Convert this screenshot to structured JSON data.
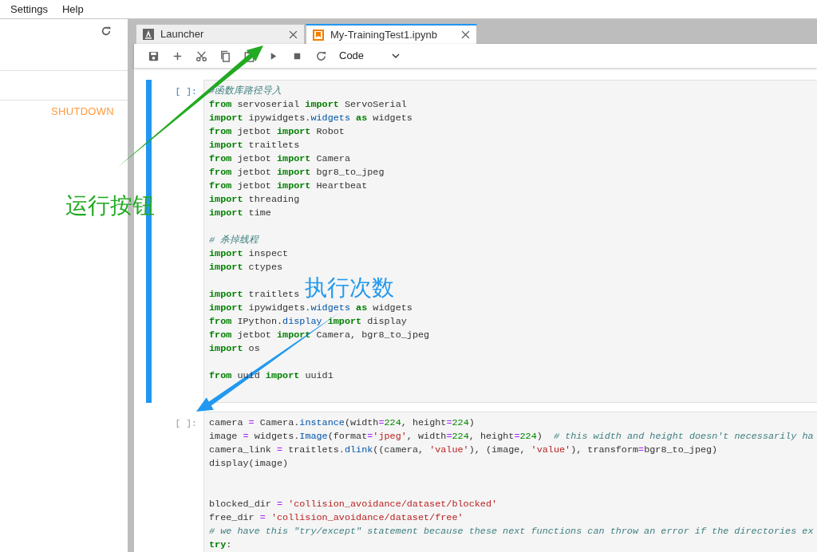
{
  "menu": [
    {
      "label": "Settings"
    },
    {
      "label": "Help"
    }
  ],
  "sidebar": {
    "shutdown": "SHUTDOWN"
  },
  "tabs": [
    {
      "label": "Launcher",
      "kind": "launcher",
      "selected": false
    },
    {
      "label": "My-TrainingTest1.ipynb",
      "kind": "notebook",
      "selected": true
    }
  ],
  "toolbar": {
    "cell_type": "Code"
  },
  "cells": [
    {
      "prompt": "[ ]:",
      "selected": true,
      "lines": [
        {
          "kind": "code",
          "tokens": [
            {
              "kind": "cmt",
              "text": "#函数库路径导入"
            }
          ]
        },
        {
          "kind": "code",
          "tokens": [
            {
              "kind": "kw",
              "text": "from"
            },
            {
              "kind": "plain",
              "text": " servoserial "
            },
            {
              "kind": "kw",
              "text": "import"
            },
            {
              "kind": "plain",
              "text": " ServoSerial"
            }
          ]
        },
        {
          "kind": "code",
          "tokens": [
            {
              "kind": "kw",
              "text": "import"
            },
            {
              "kind": "plain",
              "text": " ipywidgets."
            },
            {
              "kind": "attr",
              "text": "widgets"
            },
            {
              "kind": "kw",
              "text": " as"
            },
            {
              "kind": "plain",
              "text": " widgets"
            }
          ]
        },
        {
          "kind": "code",
          "tokens": [
            {
              "kind": "kw",
              "text": "from"
            },
            {
              "kind": "plain",
              "text": " jetbot "
            },
            {
              "kind": "kw",
              "text": "import"
            },
            {
              "kind": "plain",
              "text": " Robot"
            }
          ]
        },
        {
          "kind": "code",
          "tokens": [
            {
              "kind": "kw",
              "text": "import"
            },
            {
              "kind": "plain",
              "text": " traitlets"
            }
          ]
        },
        {
          "kind": "code",
          "tokens": [
            {
              "kind": "kw",
              "text": "from"
            },
            {
              "kind": "plain",
              "text": " jetbot "
            },
            {
              "kind": "kw",
              "text": "import"
            },
            {
              "kind": "plain",
              "text": " Camera"
            }
          ]
        },
        {
          "kind": "code",
          "tokens": [
            {
              "kind": "kw",
              "text": "from"
            },
            {
              "kind": "plain",
              "text": " jetbot "
            },
            {
              "kind": "kw",
              "text": "import"
            },
            {
              "kind": "plain",
              "text": " bgr8_to_jpeg"
            }
          ]
        },
        {
          "kind": "code",
          "tokens": [
            {
              "kind": "kw",
              "text": "from"
            },
            {
              "kind": "plain",
              "text": " jetbot "
            },
            {
              "kind": "kw",
              "text": "import"
            },
            {
              "kind": "plain",
              "text": " Heartbeat"
            }
          ]
        },
        {
          "kind": "code",
          "tokens": [
            {
              "kind": "kw",
              "text": "import"
            },
            {
              "kind": "plain",
              "text": " threading"
            }
          ]
        },
        {
          "kind": "code",
          "tokens": [
            {
              "kind": "kw",
              "text": "import"
            },
            {
              "kind": "plain",
              "text": " time"
            }
          ]
        },
        {
          "kind": "blank"
        },
        {
          "kind": "code",
          "tokens": [
            {
              "kind": "cmt",
              "text": "# 杀掉线程"
            }
          ]
        },
        {
          "kind": "code",
          "tokens": [
            {
              "kind": "kw",
              "text": "import"
            },
            {
              "kind": "plain",
              "text": " inspect"
            }
          ]
        },
        {
          "kind": "code",
          "tokens": [
            {
              "kind": "kw",
              "text": "import"
            },
            {
              "kind": "plain",
              "text": " ctypes"
            }
          ]
        },
        {
          "kind": "blank"
        },
        {
          "kind": "code",
          "tokens": [
            {
              "kind": "kw",
              "text": "import"
            },
            {
              "kind": "plain",
              "text": " traitlets"
            }
          ]
        },
        {
          "kind": "code",
          "tokens": [
            {
              "kind": "kw",
              "text": "import"
            },
            {
              "kind": "plain",
              "text": " ipywidgets."
            },
            {
              "kind": "attr",
              "text": "widgets"
            },
            {
              "kind": "kw",
              "text": " as"
            },
            {
              "kind": "plain",
              "text": " widgets"
            }
          ]
        },
        {
          "kind": "code",
          "tokens": [
            {
              "kind": "kw",
              "text": "from"
            },
            {
              "kind": "plain",
              "text": " IPython."
            },
            {
              "kind": "attr",
              "text": "display"
            },
            {
              "kind": "kw",
              "text": " import"
            },
            {
              "kind": "plain",
              "text": " display"
            }
          ]
        },
        {
          "kind": "code",
          "tokens": [
            {
              "kind": "kw",
              "text": "from"
            },
            {
              "kind": "plain",
              "text": " jetbot "
            },
            {
              "kind": "kw",
              "text": "import"
            },
            {
              "kind": "plain",
              "text": " Camera, bgr8_to_jpeg"
            }
          ]
        },
        {
          "kind": "code",
          "tokens": [
            {
              "kind": "kw",
              "text": "import"
            },
            {
              "kind": "plain",
              "text": " os"
            }
          ]
        },
        {
          "kind": "blank"
        },
        {
          "kind": "code",
          "tokens": [
            {
              "kind": "kw",
              "text": "from"
            },
            {
              "kind": "plain",
              "text": " uuid "
            },
            {
              "kind": "kw",
              "text": "import"
            },
            {
              "kind": "plain",
              "text": " uuid1"
            }
          ]
        },
        {
          "kind": "blank"
        }
      ]
    },
    {
      "prompt": "[ ]:",
      "selected": false,
      "lines": [
        {
          "kind": "code",
          "tokens": [
            {
              "kind": "plain",
              "text": "camera "
            },
            {
              "kind": "op",
              "text": "="
            },
            {
              "kind": "plain",
              "text": " Camera."
            },
            {
              "kind": "attr",
              "text": "instance"
            },
            {
              "kind": "plain",
              "text": "(width"
            },
            {
              "kind": "op",
              "text": "="
            },
            {
              "kind": "num",
              "text": "224"
            },
            {
              "kind": "plain",
              "text": ", height"
            },
            {
              "kind": "op",
              "text": "="
            },
            {
              "kind": "num",
              "text": "224"
            },
            {
              "kind": "plain",
              "text": ")"
            }
          ]
        },
        {
          "kind": "code",
          "tokens": [
            {
              "kind": "plain",
              "text": "image "
            },
            {
              "kind": "op",
              "text": "="
            },
            {
              "kind": "plain",
              "text": " widgets."
            },
            {
              "kind": "attr",
              "text": "Image"
            },
            {
              "kind": "plain",
              "text": "(format"
            },
            {
              "kind": "op",
              "text": "="
            },
            {
              "kind": "str",
              "text": "'jpeg'"
            },
            {
              "kind": "plain",
              "text": ", width"
            },
            {
              "kind": "op",
              "text": "="
            },
            {
              "kind": "num",
              "text": "224"
            },
            {
              "kind": "plain",
              "text": ", height"
            },
            {
              "kind": "op",
              "text": "="
            },
            {
              "kind": "num",
              "text": "224"
            },
            {
              "kind": "plain",
              "text": ")  "
            },
            {
              "kind": "cmt",
              "text": "# this width and height doesn't necessarily ha"
            }
          ]
        },
        {
          "kind": "code",
          "tokens": [
            {
              "kind": "plain",
              "text": "camera_link "
            },
            {
              "kind": "op",
              "text": "="
            },
            {
              "kind": "plain",
              "text": " traitlets."
            },
            {
              "kind": "attr",
              "text": "dlink"
            },
            {
              "kind": "plain",
              "text": "((camera, "
            },
            {
              "kind": "str",
              "text": "'value'"
            },
            {
              "kind": "plain",
              "text": "), (image, "
            },
            {
              "kind": "str",
              "text": "'value'"
            },
            {
              "kind": "plain",
              "text": "), transform"
            },
            {
              "kind": "op",
              "text": "="
            },
            {
              "kind": "plain",
              "text": "bgr8_to_jpeg)"
            }
          ]
        },
        {
          "kind": "code",
          "tokens": [
            {
              "kind": "plain",
              "text": "display(image)"
            }
          ]
        },
        {
          "kind": "blank"
        },
        {
          "kind": "blank"
        },
        {
          "kind": "code",
          "tokens": [
            {
              "kind": "plain",
              "text": "blocked_dir "
            },
            {
              "kind": "op",
              "text": "="
            },
            {
              "kind": "str",
              "text": " 'collision_avoidance/dataset/blocked'"
            }
          ]
        },
        {
          "kind": "code",
          "tokens": [
            {
              "kind": "plain",
              "text": "free_dir "
            },
            {
              "kind": "op",
              "text": "="
            },
            {
              "kind": "str",
              "text": " 'collision_avoidance/dataset/free'"
            }
          ]
        },
        {
          "kind": "code",
          "tokens": [
            {
              "kind": "cmt",
              "text": "# we have this \"try/except\" statement because these next functions can throw an error if the directories ex"
            }
          ]
        },
        {
          "kind": "code",
          "tokens": [
            {
              "kind": "kw",
              "text": "try"
            },
            {
              "kind": "plain",
              "text": ":"
            }
          ]
        }
      ]
    }
  ],
  "annotations": [
    {
      "text": "运行按钮",
      "color": "#22aa22"
    },
    {
      "text": "执行次数",
      "color": "#2299ee"
    }
  ]
}
